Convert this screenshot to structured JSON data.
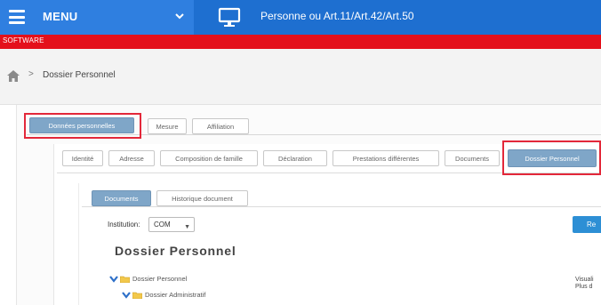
{
  "header": {
    "menu_label": "MENU",
    "app_title": "Personne ou Art.11/Art.42/Art.50",
    "environment": "SOFTWARE"
  },
  "breadcrumb": {
    "separator": ">",
    "current": "Dossier Personnel"
  },
  "main_tabs": [
    {
      "label": "Données personnelles",
      "active": true
    },
    {
      "label": "Mesure",
      "active": false
    },
    {
      "label": "Affiliation",
      "active": false
    }
  ],
  "sub_tabs": [
    {
      "label": "Identité",
      "active": false
    },
    {
      "label": "Adresse",
      "active": false
    },
    {
      "label": "Composition de famille",
      "active": false
    },
    {
      "label": "Déclaration",
      "active": false
    },
    {
      "label": "Prestations différentes",
      "active": false
    },
    {
      "label": "Documents",
      "active": false
    },
    {
      "label": "Dossier Personnel",
      "active": true
    }
  ],
  "inner_tabs": [
    {
      "label": "Documents",
      "active": true
    },
    {
      "label": "Historique document",
      "active": false
    }
  ],
  "institution": {
    "label": "Institution:",
    "value": "COM"
  },
  "action_button": {
    "label": "Re"
  },
  "section_title": "Dossier Personnel",
  "tree": [
    {
      "label": "Dossier Personnel",
      "level": 0
    },
    {
      "label": "Dossier Administratif",
      "level": 1
    }
  ],
  "side_text": [
    "Visuali",
    "Plus d"
  ],
  "colors": {
    "top_bar": "#1e6fd0",
    "menu_block": "#2f7fe0",
    "environment_bar": "#e4101b",
    "active_tab": "#7fa6c8",
    "highlight": "#e3283a",
    "button": "#2d8fd5"
  }
}
